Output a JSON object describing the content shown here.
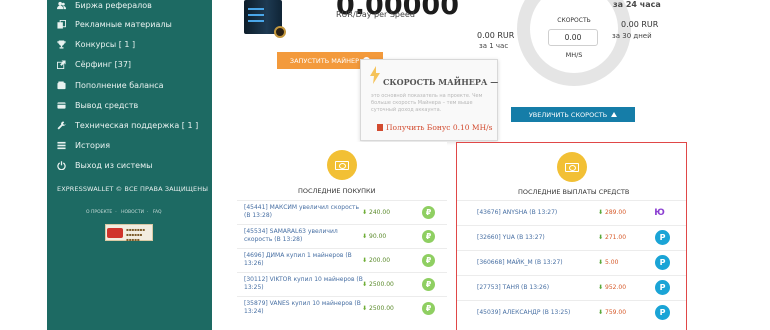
{
  "sidebar": {
    "items": [
      {
        "label": "Биржа рефералов",
        "icon": "users-icon"
      },
      {
        "label": "Рекламные материалы",
        "icon": "copy-icon"
      },
      {
        "label": "Конкурсы [ 1 ]",
        "icon": "trophy-icon"
      },
      {
        "label": "Сёрфинг [37]",
        "icon": "external-link-icon"
      },
      {
        "label": "Пополнение баланса",
        "icon": "wallet-icon"
      },
      {
        "label": "Вывод средств",
        "icon": "credit-card-icon"
      },
      {
        "label": "Техническая поддержка [ 1 ]",
        "icon": "wrench-icon"
      },
      {
        "label": "История",
        "icon": "list-icon"
      },
      {
        "label": "Выход из системы",
        "icon": "power-icon"
      }
    ],
    "copyright": "EXPRESSWALLET © ВСЕ ПРАВА ЗАЩИЩЕНЫ",
    "footer_links": [
      "О ПРОЕКТЕ",
      "НОВОСТИ",
      "FAQ"
    ]
  },
  "miner": {
    "value": "0.00000",
    "unit": "RUR/Day per Speed",
    "start_button": "ЗАПУСТИТЬ МАЙНЕР"
  },
  "tooltip": {
    "title": "СКОРОСТЬ МАЙНЕРА —",
    "description": "это основной показатель на проекте. Чем больше скорость Майнера – тем выше суточный доход аккаунта.",
    "bonus": "Получить Бонус 0.10 MH/s"
  },
  "speed": {
    "label": "СКОРОСТЬ",
    "value": "0.00",
    "unit": "MH/S",
    "increase_button": "УВЕЛИЧИТЬ СКОРОСТЬ",
    "hour_value": "0.00 RUR",
    "hour_label": "за 1 час",
    "day24_label": "за 24 часа",
    "days30_value": "0.00 RUR",
    "days30_label": "за 30 дней"
  },
  "purchases": {
    "title": "ПОСЛЕДНИЕ ПОКУПКИ",
    "rows": [
      {
        "line1": "[45441] МАКСИМ увеличил скорость",
        "line2": "(В 13:28)",
        "amount": "240.00"
      },
      {
        "line1": "[45534] SAMARAL63 увеличил",
        "line2": "скорость (В 13:28)",
        "amount": "90.00"
      },
      {
        "line1": "[4696] ДИМА купил 1 майнеров (В",
        "line2": "13:26)",
        "amount": "200.00"
      },
      {
        "line1": "[30112] VIKTOR купил 10 майнеров (В",
        "line2": "13:25)",
        "amount": "2500.00"
      },
      {
        "line1": "[35879] VANES купил 10 майнеров (В",
        "line2": "13:24)",
        "amount": "2500.00"
      }
    ]
  },
  "payouts": {
    "title": "ПОСЛЕДНИЕ ВЫПЛАТЫ СРЕДСТВ",
    "rows": [
      {
        "name": "[43676] ANYSHA (В 13:27)",
        "amount": "289.00",
        "system": "yoomoney"
      },
      {
        "name": "[32660] YUA (В 13:27)",
        "amount": "271.00",
        "system": "payeer"
      },
      {
        "name": "[360668] МАЙК_М (В 13:27)",
        "amount": "5.00",
        "system": "payeer"
      },
      {
        "name": "[27753] ТАНЯ (В 13:26)",
        "amount": "952.00",
        "system": "payeer"
      },
      {
        "name": "[45039] АЛЕКСАНДР (В 13:25)",
        "amount": "759.00",
        "system": "payeer"
      }
    ]
  },
  "colors": {
    "sidebar": "#1d6a63",
    "accent_orange": "#f39a3c",
    "accent_blue": "#157da8",
    "highlight_border": "#e04848",
    "coin": "#f2c035"
  }
}
